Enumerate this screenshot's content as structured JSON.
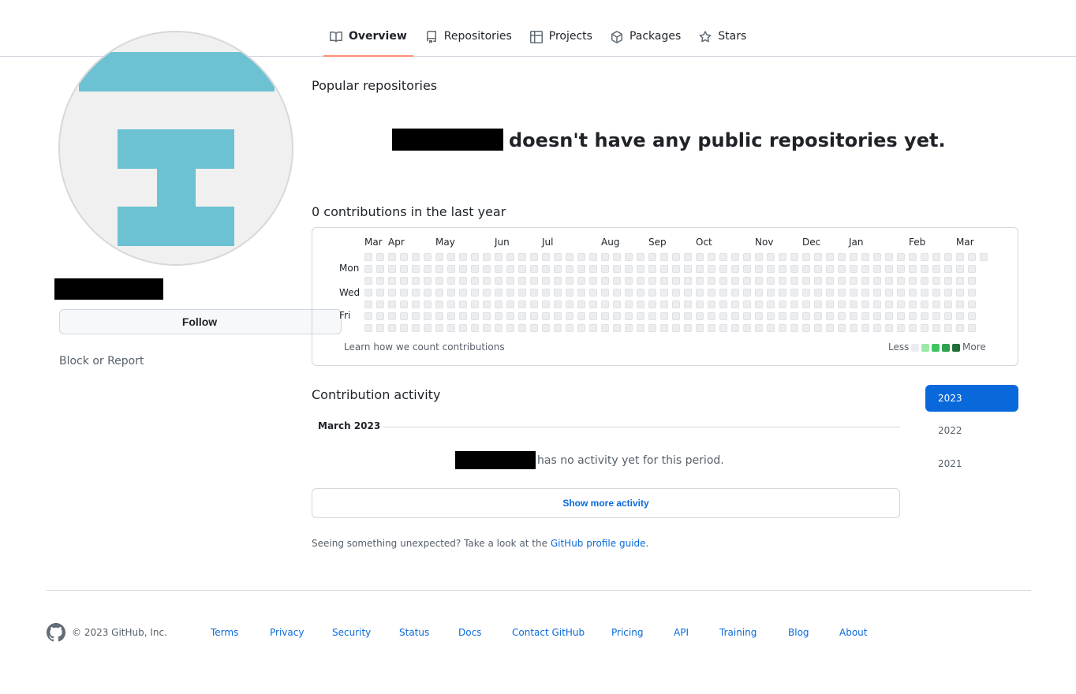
{
  "nav": {
    "tabs": [
      {
        "label": "Overview",
        "icon": "book-icon",
        "active": true
      },
      {
        "label": "Repositories",
        "icon": "repo-icon"
      },
      {
        "label": "Projects",
        "icon": "table-icon"
      },
      {
        "label": "Packages",
        "icon": "package-icon"
      },
      {
        "label": "Stars",
        "icon": "star-icon"
      }
    ]
  },
  "sidebar": {
    "follow_label": "Follow",
    "block_label": "Block or Report",
    "avatar_color": "#6cc2d3"
  },
  "popular": {
    "heading": "Popular repositories",
    "empty_message": "doesn't have any public repositories yet."
  },
  "contributions": {
    "heading": "0 contributions in the last year",
    "months": [
      "Mar",
      "Apr",
      "May",
      "Jun",
      "Jul",
      "Aug",
      "Sep",
      "Oct",
      "Nov",
      "Dec",
      "Jan",
      "Feb",
      "Mar"
    ],
    "weekdays": [
      "Mon",
      "Wed",
      "Fri"
    ],
    "learn_link": "Learn how we count contributions",
    "legend_less": "Less",
    "legend_more": "More",
    "legend_colors": [
      "#ebedf0",
      "#9be9a8",
      "#40c463",
      "#30a14e",
      "#216e39"
    ],
    "empty_color": "#ebedf0"
  },
  "activity": {
    "heading": "Contribution activity",
    "month_label": "March 2023",
    "no_activity": "has no activity yet for this period.",
    "show_more": "Show more activity",
    "guide_text": "Seeing something unexpected? Take a look at the ",
    "guide_link": "GitHub profile guide",
    "guide_end": ".",
    "years": [
      "2023",
      "2022",
      "2021"
    ]
  },
  "footer": {
    "copyright": "© 2023 GitHub, Inc.",
    "links": [
      "Terms",
      "Privacy",
      "Security",
      "Status",
      "Docs",
      "Contact GitHub",
      "Pricing",
      "API",
      "Training",
      "Blog",
      "About"
    ]
  }
}
